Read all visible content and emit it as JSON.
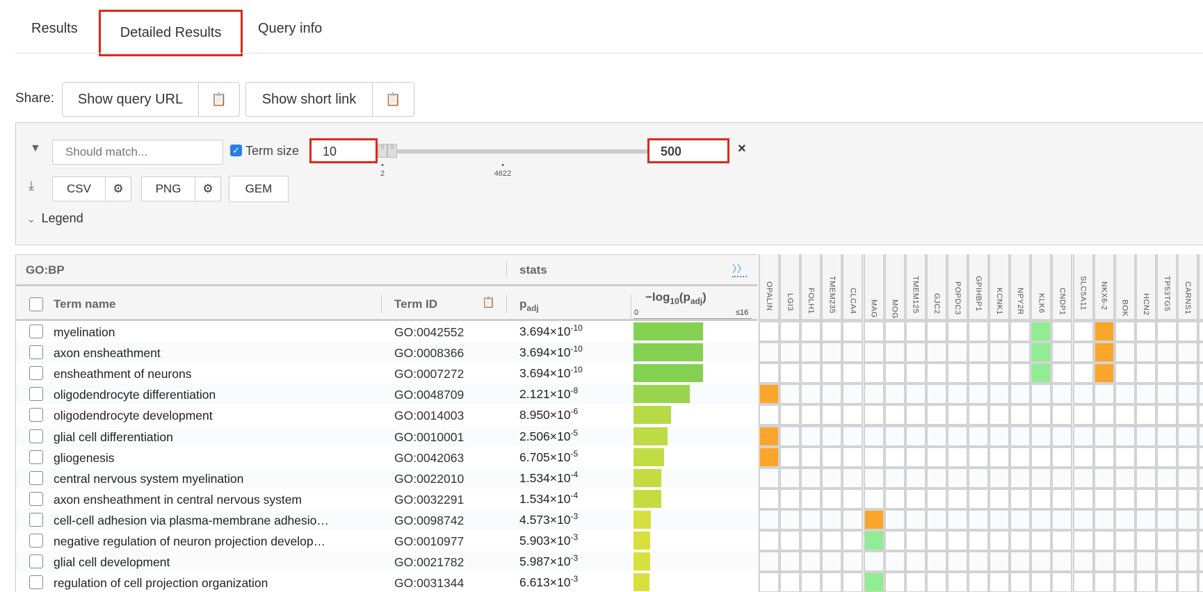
{
  "tabs": [
    {
      "label": "Results"
    },
    {
      "label": "Detailed Results",
      "active": true
    },
    {
      "label": "Query info"
    }
  ],
  "share": {
    "label": "Share:",
    "query_url": "Show query URL",
    "short_link": "Show short link"
  },
  "filter": {
    "placeholder": "Should match...",
    "term_size_label": "Term size",
    "term_size_checked": true,
    "min": "10",
    "max": "500",
    "tick_min": "2",
    "tick_mid": "4622",
    "clear": "×"
  },
  "export": {
    "csv": "CSV",
    "png": "PNG",
    "gem": "GEM"
  },
  "legend": {
    "label": "Legend"
  },
  "table": {
    "source": "GO:BP",
    "stats": "stats",
    "expand": "〉〉",
    "col_term_name": "Term name",
    "col_term_id": "Term ID",
    "col_padj": "p",
    "col_padj_sub": "adj",
    "col_log": "−log",
    "col_log_sub10": "10",
    "col_log_p": "(p",
    "col_log_sub": "adj",
    "col_log_close": ")",
    "axis_min": "0",
    "axis_max": "≤16",
    "axis_max_value": 16,
    "genes": [
      "OPALIN",
      "LGI3",
      "FOLH1",
      "TMEM235",
      "CLCA4",
      "MAG",
      "MOG",
      "TMEM125",
      "GJC2",
      "POPDC3",
      "GPIHBP1",
      "KCNK1",
      "NPY2R",
      "KLK6",
      "CNDP1",
      "SLC5A11",
      "NKX6-2",
      "BOK",
      "HCN2",
      "TP53TG5",
      "CARNS1"
    ],
    "colors": {
      "orange": "#fba52b",
      "green": "#92ec93"
    },
    "rows": [
      {
        "name": "myelination",
        "id": "GO:0042552",
        "mant": "3.694",
        "exp": "-10",
        "neglog": 9.43,
        "cells": {
          "KLK6": "green",
          "NKX6-2": "orange"
        }
      },
      {
        "name": "axon ensheathment",
        "id": "GO:0008366",
        "mant": "3.694",
        "exp": "-10",
        "neglog": 9.43,
        "cells": {
          "KLK6": "green",
          "NKX6-2": "orange"
        }
      },
      {
        "name": "ensheathment of neurons",
        "id": "GO:0007272",
        "mant": "3.694",
        "exp": "-10",
        "neglog": 9.43,
        "cells": {
          "KLK6": "green",
          "NKX6-2": "orange"
        }
      },
      {
        "name": "oligodendrocyte differentiation",
        "id": "GO:0048709",
        "mant": "2.121",
        "exp": "-8",
        "neglog": 7.67,
        "cells": {
          "OPALIN": "orange"
        }
      },
      {
        "name": "oligodendrocyte development",
        "id": "GO:0014003",
        "mant": "8.950",
        "exp": "-6",
        "neglog": 5.05,
        "cells": {}
      },
      {
        "name": "glial cell differentiation",
        "id": "GO:0010001",
        "mant": "2.506",
        "exp": "-5",
        "neglog": 4.6,
        "cells": {
          "OPALIN": "orange"
        }
      },
      {
        "name": "gliogenesis",
        "id": "GO:0042063",
        "mant": "6.705",
        "exp": "-5",
        "neglog": 4.17,
        "cells": {
          "OPALIN": "orange"
        }
      },
      {
        "name": "central nervous system myelination",
        "id": "GO:0022010",
        "mant": "1.534",
        "exp": "-4",
        "neglog": 3.81,
        "cells": {}
      },
      {
        "name": "axon ensheathment in central nervous system",
        "id": "GO:0032291",
        "mant": "1.534",
        "exp": "-4",
        "neglog": 3.81,
        "cells": {}
      },
      {
        "name": "cell-cell adhesion via plasma-membrane adhesio…",
        "id": "GO:0098742",
        "mant": "4.573",
        "exp": "-3",
        "neglog": 2.34,
        "cells": {
          "MAG": "orange"
        }
      },
      {
        "name": "negative regulation of neuron projection develop…",
        "id": "GO:0010977",
        "mant": "5.903",
        "exp": "-3",
        "neglog": 2.23,
        "cells": {
          "MAG": "green"
        }
      },
      {
        "name": "glial cell development",
        "id": "GO:0021782",
        "mant": "5.987",
        "exp": "-3",
        "neglog": 2.22,
        "cells": {}
      },
      {
        "name": "regulation of cell projection organization",
        "id": "GO:0031344",
        "mant": "6.613",
        "exp": "-3",
        "neglog": 2.18,
        "cells": {
          "MAG": "green"
        }
      }
    ]
  }
}
